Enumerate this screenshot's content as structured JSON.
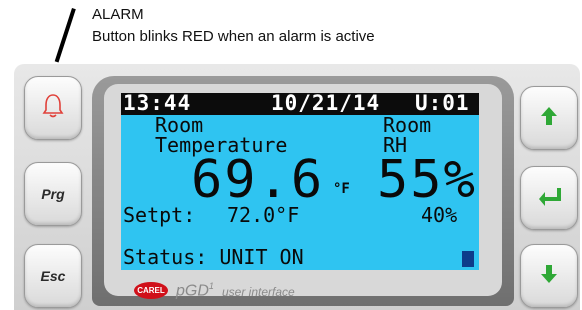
{
  "annotation": {
    "title": "ALARM",
    "description": "Button blinks RED when an alarm is active"
  },
  "buttons": {
    "left": [
      {
        "name": "alarm",
        "icon": "bell-icon",
        "color": "#e0413a"
      },
      {
        "name": "prg",
        "label": "Prg"
      },
      {
        "name": "esc",
        "label": "Esc"
      }
    ],
    "right": [
      {
        "name": "up",
        "icon": "arrow-up-icon",
        "color": "#2fa836"
      },
      {
        "name": "enter",
        "icon": "enter-icon",
        "color": "#2fa836"
      },
      {
        "name": "down",
        "icon": "arrow-down-icon",
        "color": "#2fa836"
      }
    ]
  },
  "screen": {
    "time": "13:44",
    "date": "10/21/14",
    "unit": "U:01",
    "room_temp_label_1": "Room",
    "room_temp_label_2": "Temperature",
    "room_rh_label_1": "Room",
    "room_rh_label_2": "RH",
    "temp_value": "69.6",
    "temp_unit": "°F",
    "rh_value": "55%",
    "setpt_label": "Setpt:",
    "setpt_temp": "72.0°F",
    "setpt_rh": "40%",
    "status": "Status: UNIT ON",
    "colors": {
      "background": "#2fc4f1",
      "header": "#0c0c0c"
    }
  },
  "footer": {
    "logo": "CAREL",
    "brand": "pGD",
    "brand_sup": "1",
    "tagline": "user interface"
  }
}
